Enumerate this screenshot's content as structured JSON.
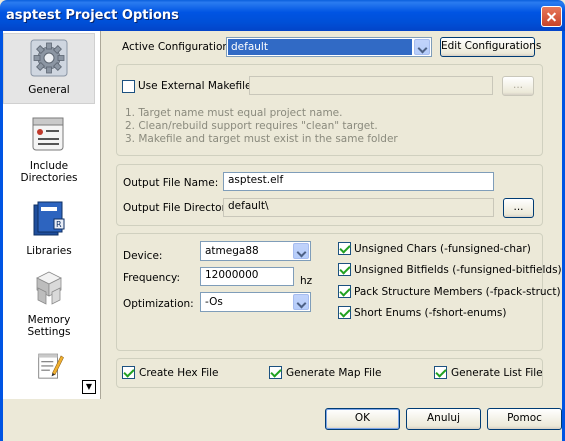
{
  "window": {
    "title": "asptest Project Options"
  },
  "sidebar": {
    "items": [
      {
        "label": "General",
        "icon": "gear-icon"
      },
      {
        "label": "Include Directories",
        "icon": "include-directories-icon"
      },
      {
        "label": "Libraries",
        "icon": "books-icon"
      },
      {
        "label": "Memory Settings",
        "icon": "memory-blocks-icon"
      },
      {
        "label": "",
        "icon": "notepad-pencil-icon"
      }
    ],
    "scroll_glyph": "▼"
  },
  "config": {
    "active_label": "Active Configuration",
    "active_value": "default",
    "edit_button": "Edit Configurations"
  },
  "makefile": {
    "use_external_label": "Use External Makefile",
    "use_external_checked": false,
    "path_value": "",
    "browse_label": "...",
    "notes": [
      "1. Target name must equal project name.",
      "2. Clean/rebuild support requires \"clean\" target.",
      "3. Makefile and target must exist in the same folder"
    ]
  },
  "output": {
    "file_name_label": "Output File Name:",
    "file_name_value": "asptest.elf",
    "directory_label": "Output File Directory:",
    "directory_value": "default\\",
    "browse_label": "..."
  },
  "device": {
    "device_label": "Device:",
    "device_value": "atmega88",
    "frequency_label": "Frequency:",
    "frequency_value": "12000000",
    "frequency_unit": "hz",
    "optimization_label": "Optimization:",
    "optimization_value": "-Os",
    "options": [
      {
        "label": "Unsigned Chars (-funsigned-char)",
        "checked": true
      },
      {
        "label": "Unsigned Bitfields (-funsigned-bitfields)",
        "checked": true
      },
      {
        "label": "Pack Structure Members (-fpack-struct)",
        "checked": true
      },
      {
        "label": "Short Enums (-fshort-enums)",
        "checked": true
      }
    ]
  },
  "generate": {
    "hex_label": "Create Hex File",
    "hex_checked": true,
    "map_label": "Generate Map File",
    "map_checked": true,
    "list_label": "Generate List File",
    "list_checked": true
  },
  "buttons": {
    "ok": "OK",
    "cancel": "Anuluj",
    "help": "Pomoc"
  },
  "colors": {
    "titlebar": "#0054e3",
    "selection": "#316ac5",
    "check": "#21a121"
  }
}
